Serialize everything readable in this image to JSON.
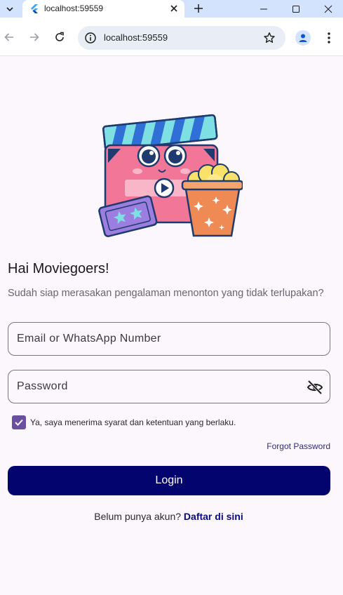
{
  "browser": {
    "tab_title": "localhost:59559",
    "url": "localhost:59559"
  },
  "page": {
    "headline": "Hai Moviegoers!",
    "subtitle": "Sudah siap merasakan pengalaman menonton yang tidak terlupakan?",
    "email_placeholder": "Email or WhatsApp Number",
    "password_placeholder": "Password",
    "terms_label": "Ya, saya menerima syarat dan ketentuan yang berlaku.",
    "terms_checked": true,
    "forgot_password": "Forgot Password",
    "login_label": "Login",
    "signup_prompt": "Belum punya akun?",
    "signup_link": "Daftar di sini"
  },
  "colors": {
    "primary_button": "#04046e",
    "checkbox": "#6a4fa0",
    "background": "#fcf6fd",
    "link": "#0a0a7a"
  },
  "icons": {
    "tab_favicon": "flutter-logo-icon",
    "password_toggle": "eye-off-icon",
    "hero": "clapperboard-popcorn-ticket-illustration"
  }
}
